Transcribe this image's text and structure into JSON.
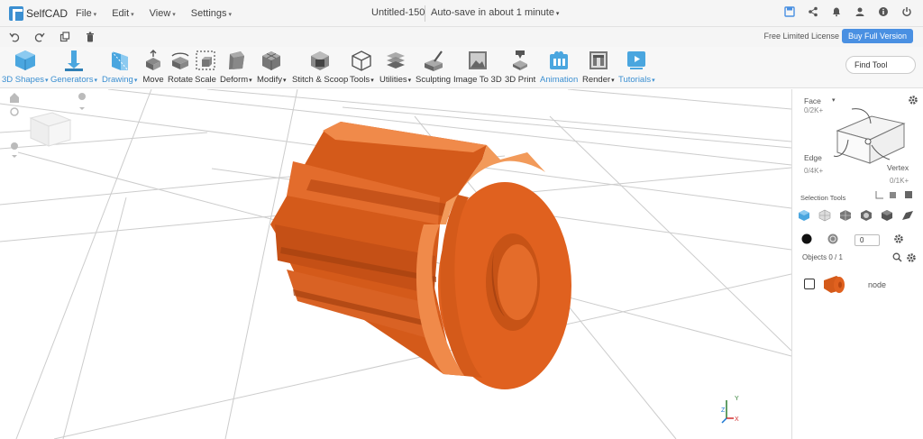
{
  "app": {
    "name": "SelfCAD"
  },
  "menu": [
    {
      "label": "File"
    },
    {
      "label": "Edit"
    },
    {
      "label": "View"
    },
    {
      "label": "Settings"
    }
  ],
  "document": {
    "title": "Untitled-150",
    "autosave": "Auto-save in about 1 minute"
  },
  "top_icons": [
    "save-icon",
    "share-icon",
    "bell-icon",
    "user-icon",
    "info-icon",
    "power-icon"
  ],
  "license": {
    "text": "Free Limited License",
    "buy_label": "Buy Full Version"
  },
  "toolbar": {
    "tools": [
      {
        "label": "3D Shapes",
        "icon": "cube-icon",
        "dropdown": true,
        "blue": true
      },
      {
        "label": "Generators",
        "icon": "generator-icon",
        "dropdown": true,
        "blue": true
      },
      {
        "label": "Drawing",
        "icon": "drawing-icon",
        "dropdown": true,
        "blue": true
      },
      {
        "label": "Move",
        "icon": "move-icon",
        "dropdown": false,
        "blue": false
      },
      {
        "label": "Rotate",
        "icon": "rotate-icon",
        "dropdown": false,
        "blue": false
      },
      {
        "label": "Scale",
        "icon": "scale-icon",
        "dropdown": false,
        "blue": false
      },
      {
        "label": "Deform",
        "icon": "deform-icon",
        "dropdown": true,
        "blue": false
      },
      {
        "label": "Modify",
        "icon": "modify-icon",
        "dropdown": true,
        "blue": false
      },
      {
        "label": "Stitch & Scoop",
        "icon": "stitch-scoop-icon",
        "dropdown": false,
        "blue": false
      },
      {
        "label": "Tools",
        "icon": "tools-icon",
        "dropdown": true,
        "blue": false
      },
      {
        "label": "Utilities",
        "icon": "utilities-icon",
        "dropdown": true,
        "blue": false
      },
      {
        "label": "Sculpting",
        "icon": "sculpting-icon",
        "dropdown": false,
        "blue": false
      },
      {
        "label": "Image To 3D",
        "icon": "image-to-3d-icon",
        "dropdown": false,
        "blue": false
      },
      {
        "label": "3D Print",
        "icon": "3d-print-icon",
        "dropdown": false,
        "blue": false
      },
      {
        "label": "Animation",
        "icon": "animation-icon",
        "dropdown": false,
        "blue": true
      },
      {
        "label": "Render",
        "icon": "render-icon",
        "dropdown": true,
        "blue": false
      },
      {
        "label": "Tutorials",
        "icon": "tutorials-icon",
        "dropdown": true,
        "blue": true
      }
    ],
    "find_tool_label": "Find Tool"
  },
  "panel": {
    "face_label": "Face",
    "face_count": "0/2K+",
    "edge_label": "Edge",
    "edge_count": "0/4K+",
    "vertex_label": "Vertex",
    "vertex_count": "0/1K+",
    "selection_tools_label": "Selection Tools",
    "stepper_value": "0",
    "objects_label": "Objects 0 / 1",
    "object_name": "node"
  },
  "colors": {
    "accent": "#4a90e2",
    "object": "#e0611f"
  }
}
